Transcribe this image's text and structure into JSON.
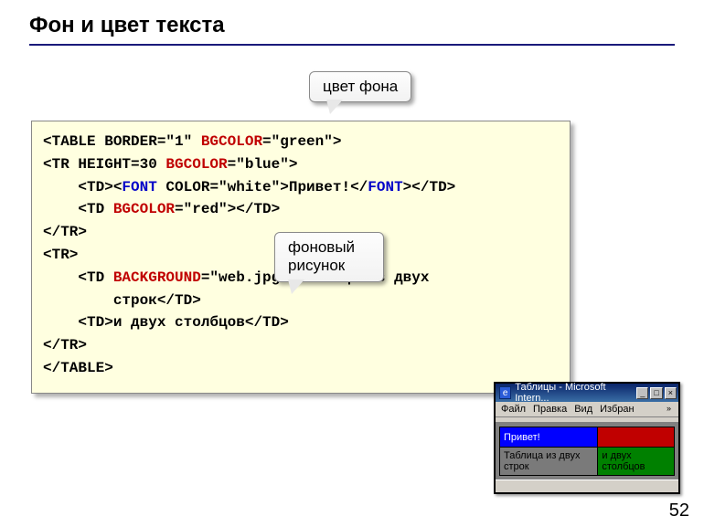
{
  "title": "Фон и цвет текста",
  "callouts": {
    "bgcolor": "цвет фона",
    "background": "фоновый рисунок"
  },
  "code": {
    "l1a": "<TABLE BORDER=\"1\" ",
    "l1b": "BGCOLOR",
    "l1c": "=\"green\">",
    "l2a": "<TR HEIGHT=30 ",
    "l2b": "BGCOLOR",
    "l2c": "=\"blue\">",
    "l3a": "    <TD><",
    "l3b": "FONT",
    "l3c": " COLOR=\"white\">Привет!</",
    "l3d": "FONT",
    "l3e": "></TD>",
    "l4a": "    <TD ",
    "l4b": "BGCOLOR",
    "l4c": "=\"red\"></TD>",
    "l5": "</TR>",
    "l6": "<TR>",
    "l7a": "    <TD ",
    "l7b": "BACKGROUND",
    "l7c": "=\"web.jpg\">Таблица из двух",
    "l8": "        строк</TD>",
    "l9": "    <TD>и двух столбцов</TD>",
    "l10": "</TR>",
    "l11": "</TABLE>"
  },
  "window": {
    "title": "Таблицы - Microsoft Intern...",
    "menu": {
      "file": "Файл",
      "edit": "Правка",
      "view": "Вид",
      "fav": "Избран"
    },
    "cells": {
      "hi": "Привет!",
      "row2a": "Таблица из двух строк",
      "row2b": "и двух столбцов"
    }
  },
  "page": "52"
}
